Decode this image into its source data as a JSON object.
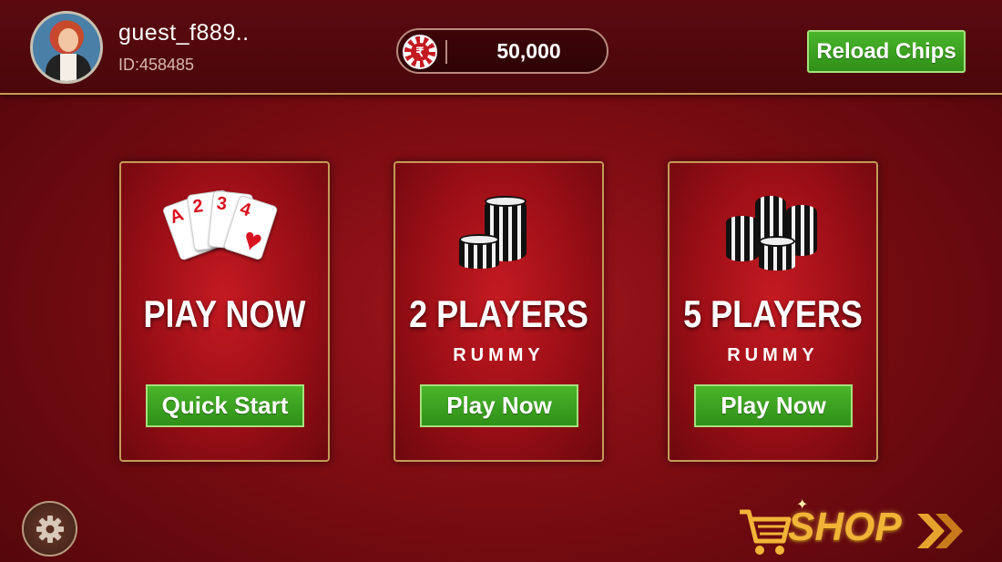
{
  "user": {
    "name": "guest_f889..",
    "id": "ID:458485"
  },
  "wallet": {
    "currency_symbol": "₹",
    "balance": "50,000",
    "reload_label": "Reload Chips"
  },
  "cards": [
    {
      "title": "PlAY NOW",
      "subtitle": "",
      "button": "Quick Start",
      "icon": "playing-cards-icon"
    },
    {
      "title": "2 PLAYERS",
      "subtitle": "RUMMY",
      "button": "Play Now",
      "icon": "chip-stack-icon"
    },
    {
      "title": "5 PLAYERS",
      "subtitle": "RUMMY",
      "button": "Play Now",
      "icon": "chip-stacks-icon"
    }
  ],
  "playing_cards": [
    "A",
    "2",
    "3",
    "4"
  ],
  "shop": {
    "label": "SHOP"
  },
  "colors": {
    "accent_green": "#3aa520",
    "background_red": "#8a0e14",
    "gold": "#c49a58"
  }
}
